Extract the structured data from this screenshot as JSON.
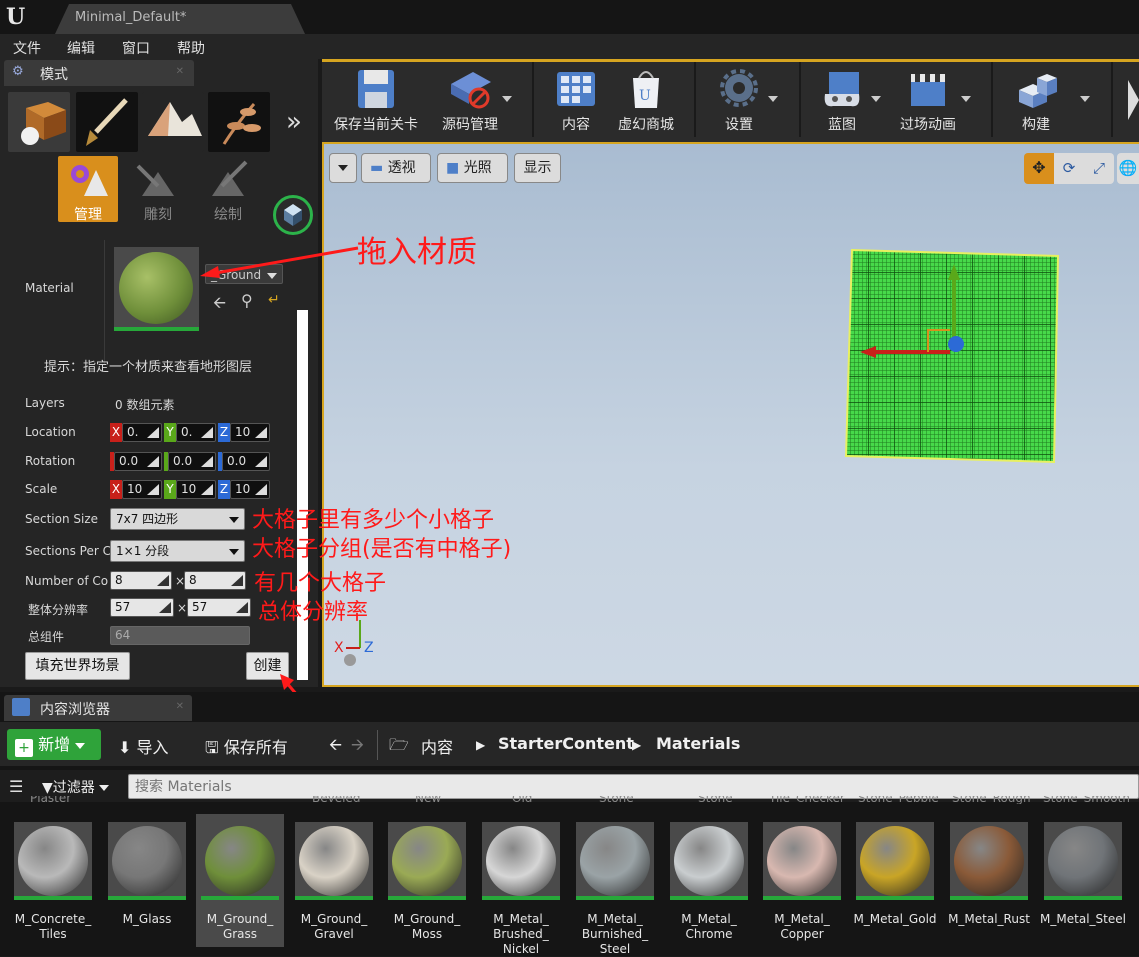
{
  "window": {
    "doc_tab": "Minimal_Default*",
    "logo": "U"
  },
  "menu": [
    "文件",
    "编辑",
    "窗口",
    "帮助"
  ],
  "modes_panel": {
    "title": "模式",
    "mode_icons": [
      "place-mode-icon",
      "paint-mode-icon",
      "landscape-mode-icon",
      "foliage-mode-icon"
    ],
    "more": "»",
    "submodes": [
      {
        "label": "管理",
        "active": true
      },
      {
        "label": "雕刻",
        "active": false
      },
      {
        "label": "绘制",
        "active": false
      }
    ],
    "material_label": "Material",
    "material_value": "_Ground",
    "hint": "提示：指定一个材质来查看地形图层",
    "layers_label": "Layers",
    "layers_value": "0 数组元素",
    "location_label": "Location",
    "location": [
      "0.",
      "0.",
      "10"
    ],
    "rotation_label": "Rotation",
    "rotation": [
      "0.0",
      "0.0",
      "0.0"
    ],
    "scale_label": "Scale",
    "scale": [
      "10",
      "10",
      "10"
    ],
    "axis": [
      "X",
      "Y",
      "Z"
    ],
    "section_size_label": "Section Size",
    "section_size": "7x7 四边形",
    "sections_per_label": "Sections Per C",
    "sections_per": "1×1 分段",
    "num_comp_label": "Number of Co",
    "num_comp": [
      "8",
      "8"
    ],
    "resolution_label": "整体分辨率",
    "resolution": [
      "57",
      "57"
    ],
    "times": "×",
    "total_label": "总组件",
    "total_value": "64",
    "fill_button": "填充世界场景",
    "create_button": "创建"
  },
  "toolbar": [
    {
      "label": "保存当前关卡",
      "icon": "save-icon",
      "drop": false
    },
    {
      "label": "源码管理",
      "icon": "source-control-icon",
      "drop": true
    },
    {
      "label": "内容",
      "icon": "content-icon",
      "drop": false
    },
    {
      "label": "虚幻商城",
      "icon": "marketplace-icon",
      "drop": false
    },
    {
      "label": "设置",
      "icon": "settings-icon",
      "drop": true
    },
    {
      "label": "蓝图",
      "icon": "blueprint-icon",
      "drop": true
    },
    {
      "label": "过场动画",
      "icon": "cinematics-icon",
      "drop": true
    },
    {
      "label": "构建",
      "icon": "build-icon",
      "drop": true
    }
  ],
  "viewport": {
    "perspective": "透视",
    "lit": "光照",
    "show": "显示",
    "axis_x": "X",
    "axis_z": "Z"
  },
  "annotations": {
    "drag_material": "拖入材质",
    "section_size": "大格子里有多少个小格子",
    "sections_per": "大格子分组(是否有中格子)",
    "num_comp": "有几个大格子",
    "resolution": "总体分辨率"
  },
  "content_browser": {
    "title": "内容浏览器",
    "new_button": "新增",
    "import_button": "导入",
    "save_all_button": "保存所有",
    "breadcrumbs": [
      "内容",
      "StarterContent",
      "Materials"
    ],
    "filter_label": "过滤器",
    "search_placeholder": "搜索 Materials",
    "top_row_labels": [
      "Plaster",
      "Beveled",
      "New",
      "Old",
      "Stone",
      "_Stone",
      "Tile_Checker",
      "Stone_Pebble",
      "Stone_Rough",
      "Stone_Smooth"
    ],
    "assets": [
      {
        "name": "M_Concrete_ Tiles",
        "color": "#b9b9b9",
        "selected": false
      },
      {
        "name": "M_Glass",
        "color": "#777777",
        "selected": false
      },
      {
        "name": "M_Ground_ Grass",
        "color": "#6f8f3a",
        "selected": true
      },
      {
        "name": "M_Ground_ Gravel",
        "color": "#d9d2c6",
        "selected": false
      },
      {
        "name": "M_Ground_ Moss",
        "color": "#9aaa55",
        "selected": false
      },
      {
        "name": "M_Metal_ Brushed_ Nickel",
        "color": "#d6d6d6",
        "selected": false
      },
      {
        "name": "M_Metal_ Burnished_ Steel",
        "color": "#9aa3a6",
        "selected": false
      },
      {
        "name": "M_Metal_ Chrome",
        "color": "#c9cdcf",
        "selected": false
      },
      {
        "name": "M_Metal_ Copper",
        "color": "#d8b8b0",
        "selected": false
      },
      {
        "name": "M_Metal_Gold",
        "color": "#c9a526",
        "selected": false
      },
      {
        "name": "M_Metal_Rust",
        "color": "#8a5a38",
        "selected": false
      },
      {
        "name": "M_Metal_Steel",
        "color": "#707478",
        "selected": false
      }
    ]
  }
}
